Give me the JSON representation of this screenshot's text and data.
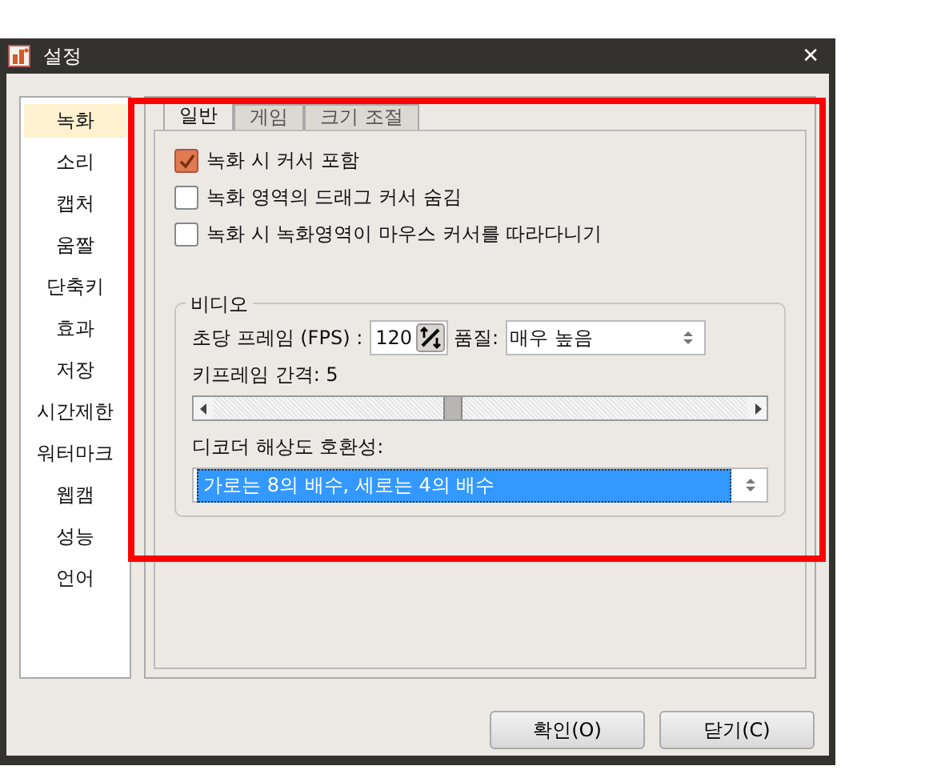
{
  "window": {
    "title": "설정",
    "close": "✕"
  },
  "sidebar": {
    "items": [
      {
        "label": "녹화",
        "selected": true
      },
      {
        "label": "소리",
        "selected": false
      },
      {
        "label": "캡처",
        "selected": false
      },
      {
        "label": "움짤",
        "selected": false
      },
      {
        "label": "단축키",
        "selected": false
      },
      {
        "label": "효과",
        "selected": false
      },
      {
        "label": "저장",
        "selected": false
      },
      {
        "label": "시간제한",
        "selected": false
      },
      {
        "label": "워터마크",
        "selected": false
      },
      {
        "label": "웹캠",
        "selected": false
      },
      {
        "label": "성능",
        "selected": false
      },
      {
        "label": "언어",
        "selected": false
      }
    ]
  },
  "tabs": [
    {
      "label": "일반",
      "selected": true
    },
    {
      "label": "게임",
      "selected": false
    },
    {
      "label": "크기 조절",
      "selected": false
    }
  ],
  "options": [
    {
      "label": "녹화 시 커서 포함",
      "checked": true
    },
    {
      "label": "녹화 영역의 드래그 커서 숨김",
      "checked": false
    },
    {
      "label": "녹화 시 녹화영역이 마우스 커서를 따라다니기",
      "checked": false
    }
  ],
  "video": {
    "title": "비디오",
    "fps_label": "초당 프레임 (FPS) :",
    "fps_value": "120",
    "quality_label": "품질:",
    "quality_value": "매우 높음",
    "keyframe_label": "키프레임 간격: 5",
    "keyframe_slider": {
      "level": 0.45
    },
    "decoder_label": "디코더 해상도 호환성:",
    "decoder_value": "가로는 8의 배수, 세로는 4의 배수"
  },
  "highlight": true,
  "buttons": [
    "확인(O)",
    "닫기(C)"
  ]
}
